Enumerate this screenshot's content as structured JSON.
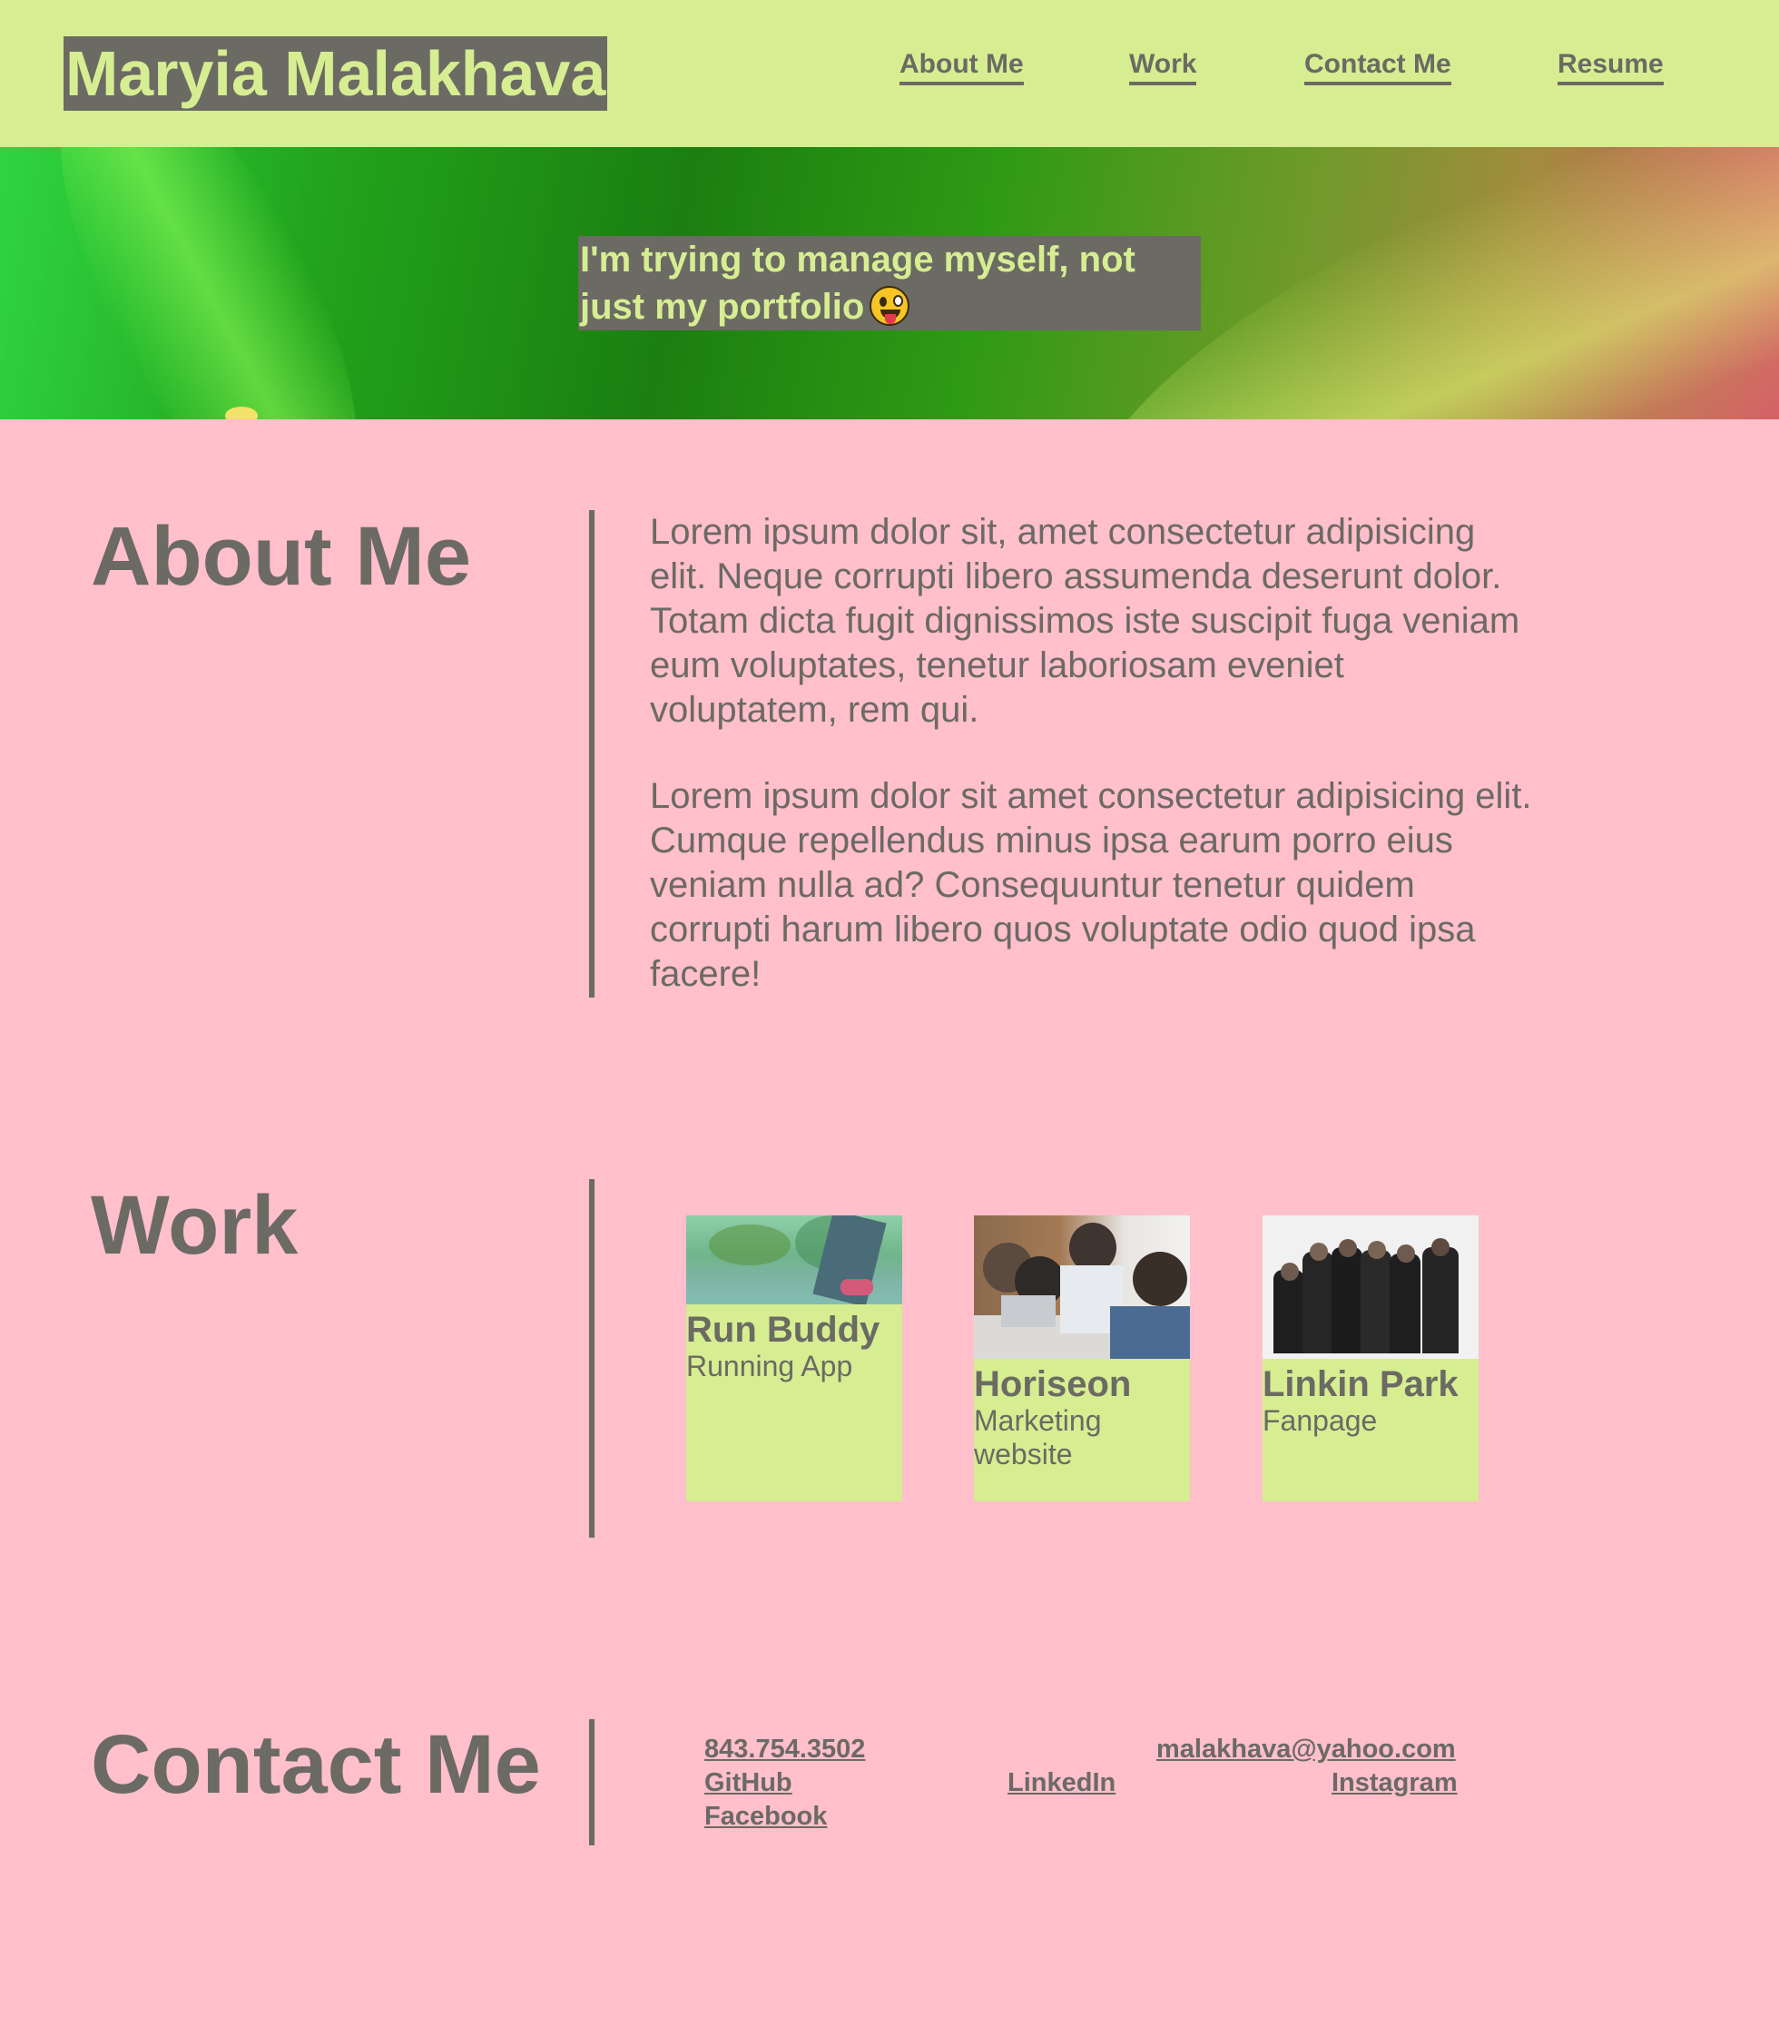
{
  "header": {
    "title": "Maryia Malakhava",
    "nav": [
      "About Me",
      "Work",
      "Contact Me",
      "Resume"
    ],
    "bg_color": "#d6ed92"
  },
  "hero": {
    "tagline_line1": "I'm trying to manage myself, not",
    "tagline_line2": "just my portfolio",
    "emoji": "winking-face-with-tongue-icon"
  },
  "about": {
    "title": "About Me",
    "paragraphs": [
      "Lorem ipsum dolor sit, amet consectetur adipisicing elit. Neque corrupti libero assumenda deserunt dolor. Totam dicta fugit dignissimos iste suscipit fuga veniam eum voluptates, tenetur laboriosam eveniet voluptatem, rem qui.",
      "Lorem ipsum dolor sit amet consectetur adipisicing elit. Cumque repellendus minus ipsa earum porro eius veniam nulla ad? Consequuntur tenetur quidem corrupti harum libero quos voluptate odio quod ipsa facere!"
    ]
  },
  "work": {
    "title": "Work",
    "projects": [
      {
        "title": "Run Buddy",
        "subtitle": "Running App"
      },
      {
        "title": "Horiseon",
        "subtitle": "Marketing website"
      },
      {
        "title": "Linkin Park",
        "subtitle": "Fanpage"
      }
    ]
  },
  "contact": {
    "title": "Contact Me",
    "phone": "843.754.3502",
    "email": "malakhava@yahoo.com",
    "github": "GitHub",
    "linkedin": "LinkedIn",
    "instagram": "Instagram",
    "facebook": "Facebook"
  },
  "colors": {
    "page_bg": "#ffbfcb",
    "accent_green": "#d6ed92",
    "text_gray": "#6b6a63"
  }
}
